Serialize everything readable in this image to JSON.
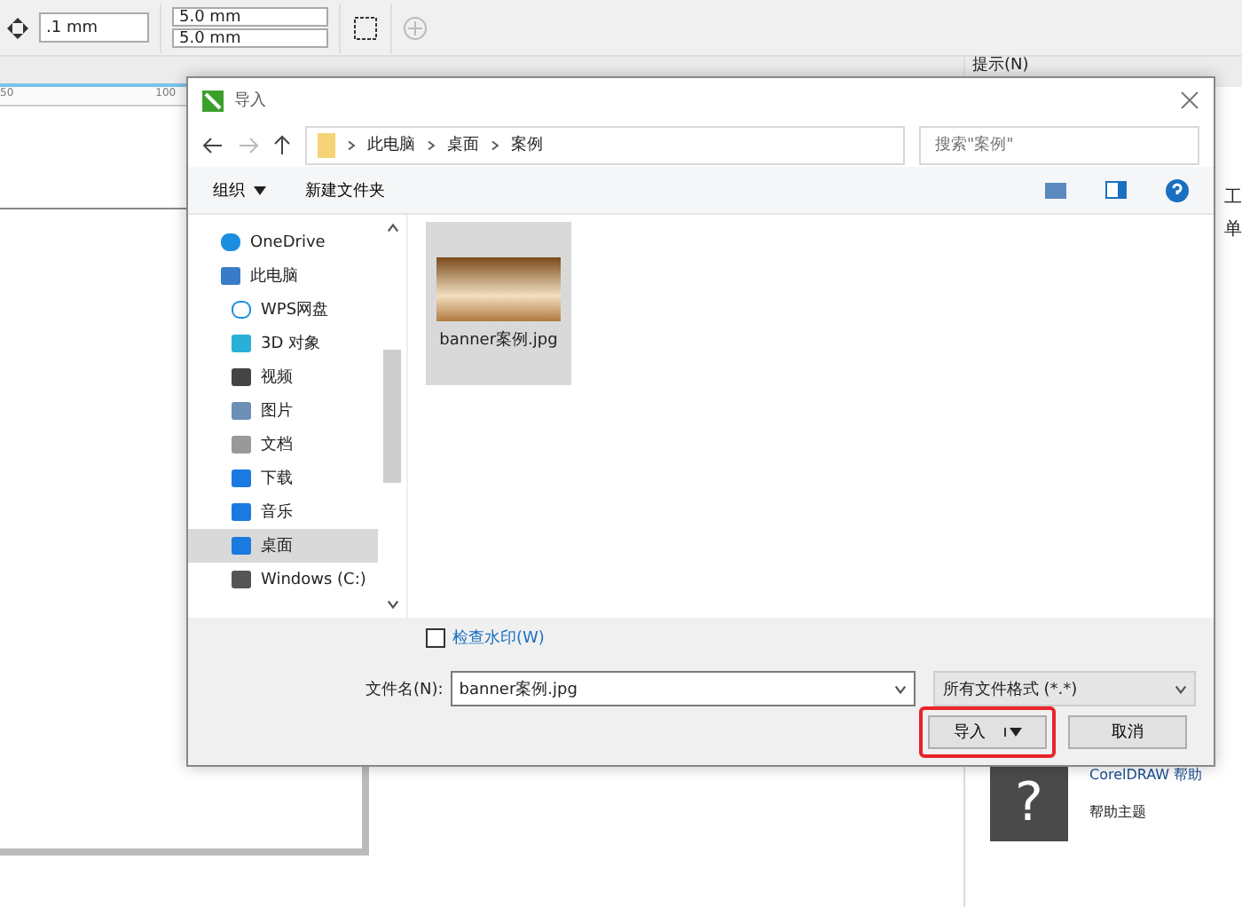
{
  "toolbar": {
    "nudge": ".1 mm",
    "dup_x": "5.0 mm",
    "dup_y": "5.0 mm"
  },
  "ruler": {
    "ticks": [
      "50",
      "100"
    ]
  },
  "hints_panel": {
    "title": "提示(N)",
    "cut_texts": [
      "工",
      "单"
    ],
    "help_mark": "?",
    "help_link": "CorelDRAW 帮助",
    "help_topic": "帮助主题"
  },
  "dialog": {
    "title": "导入",
    "path": [
      "此电脑",
      "桌面",
      "案例"
    ],
    "search": {
      "placeholder": "搜索\"案例\""
    },
    "commands": [
      {
        "label": "组织",
        "kind": "menu"
      },
      {
        "label": "新建文件夹",
        "kind": "plain"
      }
    ],
    "nav": [
      {
        "label": "OneDrive",
        "selected": false
      },
      {
        "label": "此电脑",
        "selected": false,
        "children": [
          {
            "label": "WPS网盘",
            "selected": false
          },
          {
            "label": "3D 对象",
            "selected": false
          },
          {
            "label": "视频",
            "selected": false
          },
          {
            "label": "图片",
            "selected": false
          },
          {
            "label": "文档",
            "selected": false
          },
          {
            "label": "下载",
            "selected": false
          },
          {
            "label": "音乐",
            "selected": false
          },
          {
            "label": "桌面",
            "selected": true
          },
          {
            "label": "Windows (C:)",
            "selected": false
          }
        ]
      }
    ],
    "files": [
      {
        "name": "banner案例.jpg",
        "selected": true
      }
    ],
    "watermark": {
      "label": "检查水印(W)",
      "checked": false
    },
    "filename_label": "文件名(N):",
    "filename": "banner案例.jpg",
    "filter": "所有文件格式 (*.*)",
    "buttons": [
      {
        "label": "导入",
        "kind": "split",
        "highlighted": true
      },
      {
        "label": "取消",
        "kind": "plain",
        "highlighted": false
      }
    ]
  }
}
